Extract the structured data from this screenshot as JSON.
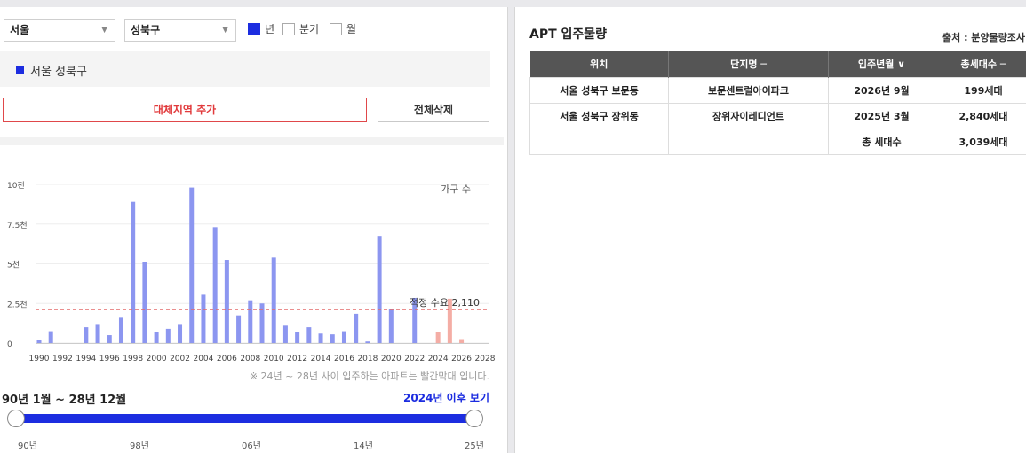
{
  "filters": {
    "city": "서울",
    "district": "성북구",
    "period_options": [
      {
        "label": "년",
        "checked": true
      },
      {
        "label": "분기",
        "checked": false
      },
      {
        "label": "월",
        "checked": false
      }
    ]
  },
  "region_item": "서울 성북구",
  "buttons": {
    "add_region": "대체지역 추가",
    "delete_all": "전체삭제"
  },
  "chart_data": {
    "type": "bar",
    "series_label": "가구 수",
    "y_ticks": [
      "10천",
      "7.5천",
      "5천",
      "2.5천",
      "0"
    ],
    "ylim": [
      0,
      10000
    ],
    "x_ticks": [
      "1990",
      "1992",
      "1994",
      "1996",
      "1998",
      "2000",
      "2002",
      "2004",
      "2006",
      "2008",
      "2010",
      "2012",
      "2014",
      "2016",
      "2018",
      "2020",
      "2022",
      "2024",
      "2026",
      "2028"
    ],
    "years": [
      1990,
      1991,
      1992,
      1993,
      1994,
      1995,
      1996,
      1997,
      1998,
      1999,
      2000,
      2001,
      2002,
      2003,
      2004,
      2005,
      2006,
      2007,
      2008,
      2009,
      2010,
      2011,
      2012,
      2013,
      2014,
      2015,
      2016,
      2017,
      2018,
      2019,
      2020,
      2021,
      2022,
      2023,
      2024,
      2025,
      2026,
      2027,
      2028
    ],
    "values": [
      200,
      750,
      0,
      0,
      1000,
      1150,
      500,
      1600,
      8900,
      5100,
      700,
      900,
      1150,
      9800,
      3050,
      7300,
      5250,
      1750,
      2700,
      2500,
      5400,
      1100,
      700,
      1000,
      600,
      550,
      750,
      1850,
      100,
      6750,
      2150,
      0,
      2850,
      0,
      700,
      2800,
      250,
      0,
      0
    ],
    "future_from_year": 2024,
    "bar_color": "#8c96f0",
    "future_bar_color": "#f4ada5",
    "reference": {
      "label": "적정 수요 2,110",
      "value": 2110,
      "color": "#e46a6a"
    },
    "grid": true
  },
  "note": "※ 24년 ~ 28년 사이 입주하는 아파트는 빨간막대 입니다.",
  "range": {
    "label": "90년 1월 ~ 28년 12월",
    "link": "2024년 이후 보기",
    "ticks": [
      "90년",
      "98년",
      "06년",
      "14년",
      "25년"
    ],
    "start_fraction": 0,
    "end_fraction": 1
  },
  "right": {
    "title": "APT 입주물량",
    "source": "출처 : 분양물량조사",
    "headers": [
      "위치",
      "단지명 ─",
      "입주년월 ∨",
      "총세대수 ─"
    ],
    "rows": [
      [
        "서울 성북구 보문동",
        "보문센트럴아이파크",
        "2026년 9월",
        "199세대"
      ],
      [
        "서울 성북구 장위동",
        "장위자이레디언트",
        "2025년 3월",
        "2,840세대"
      ],
      [
        "",
        "",
        "총 세대수",
        "3,039세대"
      ]
    ]
  },
  "colors": {
    "accent": "#1c2de0",
    "danger": "#e13a3c",
    "header_bg": "#555555"
  }
}
